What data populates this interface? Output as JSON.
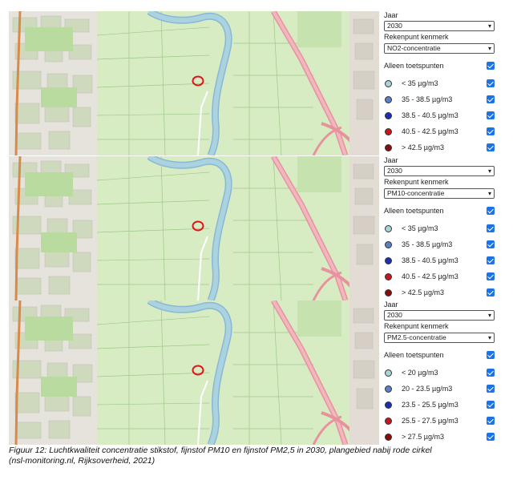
{
  "panels": [
    {
      "year_label": "Jaar",
      "year_value": "2030",
      "metric_label": "Rekenpunt kenmerk",
      "metric_value": "NO2-concentratie",
      "only_points_label": "Alleen toetspunten",
      "legend": [
        {
          "label": "< 35 µg/m3",
          "color": "#a9d3d6"
        },
        {
          "label": "35 - 38.5 µg/m3",
          "color": "#5b7fc8"
        },
        {
          "label": "38.5 - 40.5 µg/m3",
          "color": "#1c2fb4"
        },
        {
          "label": "40.5 - 42.5 µg/m3",
          "color": "#c8161c"
        },
        {
          "label": "> 42.5 µg/m3",
          "color": "#8a0d0d"
        }
      ]
    },
    {
      "year_label": "Jaar",
      "year_value": "2030",
      "metric_label": "Rekenpunt kenmerk",
      "metric_value": "PM10-concentratie",
      "only_points_label": "Alleen toetspunten",
      "legend": [
        {
          "label": "< 35 µg/m3",
          "color": "#a9d3d6"
        },
        {
          "label": "35 - 38.5 µg/m3",
          "color": "#5b7fc8"
        },
        {
          "label": "38.5 - 40.5 µg/m3",
          "color": "#1c2fb4"
        },
        {
          "label": "40.5 - 42.5 µg/m3",
          "color": "#c8161c"
        },
        {
          "label": "> 42.5 µg/m3",
          "color": "#8a0d0d"
        }
      ]
    },
    {
      "year_label": "Jaar",
      "year_value": "2030",
      "metric_label": "Rekenpunt kenmerk",
      "metric_value": "PM2.5-concentratie",
      "only_points_label": "Alleen toetspunten",
      "legend": [
        {
          "label": "< 20 µg/m3",
          "color": "#a9d3d6"
        },
        {
          "label": "20 - 23.5 µg/m3",
          "color": "#5b7fc8"
        },
        {
          "label": "23.5 - 25.5 µg/m3",
          "color": "#1c2fb4"
        },
        {
          "label": "25.5 - 27.5 µg/m3",
          "color": "#c8161c"
        },
        {
          "label": "> 27.5 µg/m3",
          "color": "#8a0d0d"
        }
      ]
    }
  ],
  "caption": {
    "line1": "Figuur 12: Luchtkwaliteit concentratie stikstof, fijnstof PM10 en fijnstof PM2,5 in 2030, plangebied nabij rode cirkel",
    "line2": "(nsl-monitoring.nl, Rijksoverheid, 2021)"
  }
}
